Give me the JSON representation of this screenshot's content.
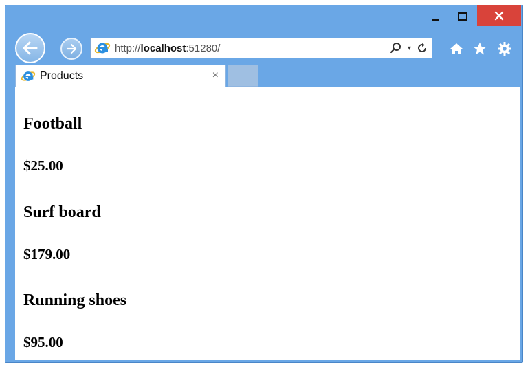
{
  "window": {
    "controls": {
      "minimize": "minimize-icon",
      "maximize": "maximize-icon",
      "close": "close-icon"
    },
    "close_color": "#d9433a",
    "frame_color": "#6aa7e6"
  },
  "navigation": {
    "back_icon": "arrow-left-icon",
    "forward_icon": "arrow-right-icon"
  },
  "address_bar": {
    "icon": "internet-explorer-icon",
    "url_prefix": "http://",
    "url_host": "localhost",
    "url_suffix": ":51280/",
    "search_icon": "search-icon",
    "refresh_icon": "refresh-icon"
  },
  "toolbar": {
    "home_icon": "home-icon",
    "favorites_icon": "star-icon",
    "settings_icon": "gear-icon"
  },
  "tabs": [
    {
      "title": "Products",
      "close_symbol": "×"
    }
  ],
  "products": [
    {
      "name": "Football",
      "price": "$25.00"
    },
    {
      "name": "Surf board",
      "price": "$179.00"
    },
    {
      "name": "Running shoes",
      "price": "$95.00"
    }
  ]
}
